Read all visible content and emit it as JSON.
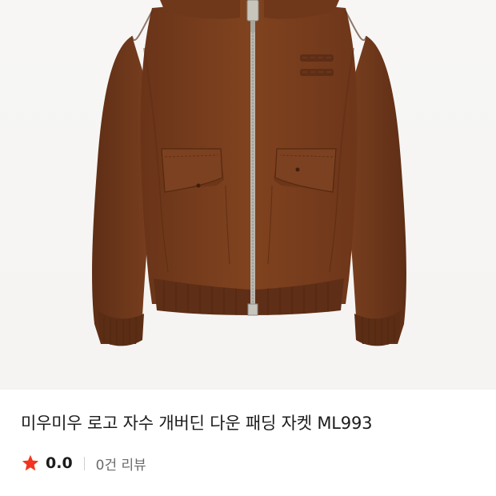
{
  "product": {
    "image_alt": "미우미우 로고 자수 개버딘 다운 패딩 자켓 ML993",
    "title": "미우미우 로고 자수 개버딘 다운 패딩 자켓 ML993",
    "rating": {
      "value": "0.0",
      "review_count_text": "0건 리뷰",
      "star_color": "#f2331e",
      "star_icon": "star-icon"
    }
  },
  "colors": {
    "jacket_main": "#7a3f22",
    "jacket_dark": "#5a2c16",
    "jacket_light": "#8d4c2b",
    "background": "#f6f5f3"
  }
}
